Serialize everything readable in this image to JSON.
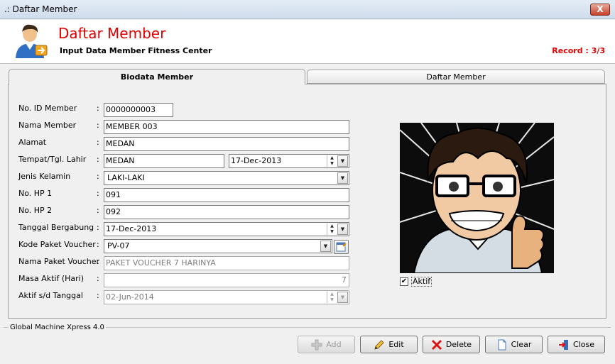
{
  "window": {
    "title": ".: Daftar Member",
    "close_glyph": "X"
  },
  "header": {
    "title": "Daftar Member",
    "subtitle": "Input Data Member Fitness Center",
    "record": "Record : 3/3",
    "icon": "member-icon"
  },
  "tabs": [
    {
      "label": "Biodata Member",
      "active": true
    },
    {
      "label": "Daftar Member",
      "active": false
    }
  ],
  "form": {
    "colon": ":",
    "id_member": {
      "label": "No. ID Member",
      "value": "0000000003"
    },
    "nama_member": {
      "label": "Nama Member",
      "value": "MEMBER 003"
    },
    "alamat": {
      "label": "Alamat",
      "value": "MEDAN"
    },
    "tempat_tgl_lahir": {
      "label": "Tempat/Tgl. Lahir",
      "tempat": "MEDAN",
      "tanggal": "17-Dec-2013"
    },
    "jenis_kelamin": {
      "label": "Jenis Kelamin",
      "value": "LAKI-LAKI"
    },
    "hp1": {
      "label": "No. HP 1",
      "value": "091"
    },
    "hp2": {
      "label": "No. HP 2",
      "value": "092"
    },
    "tanggal_bergabung": {
      "label": "Tanggal Bergabung",
      "value": "17-Dec-2013"
    },
    "kode_paket": {
      "label": "Kode Paket Voucher",
      "value": "PV-07"
    },
    "nama_paket": {
      "label": "Nama Paket Voucher",
      "value": "PAKET VOUCHER 7 HARINYA"
    },
    "masa_aktif": {
      "label": "Masa Aktif (Hari)",
      "value": "7"
    },
    "aktif_sd": {
      "label": "Aktif s/d Tanggal",
      "value": "02-Jun-2014"
    },
    "aktif": {
      "label": "Aktif",
      "checked": true,
      "check_glyph": "✔"
    }
  },
  "footer": {
    "group_label": "Global Machine Xpress 4.0"
  },
  "buttons": {
    "add": "Add",
    "edit": "Edit",
    "delete": "Delete",
    "clear": "Clear",
    "close": "Close"
  },
  "colors": {
    "title_red": "#e00000",
    "panel_bg": "#f0f0f0"
  }
}
